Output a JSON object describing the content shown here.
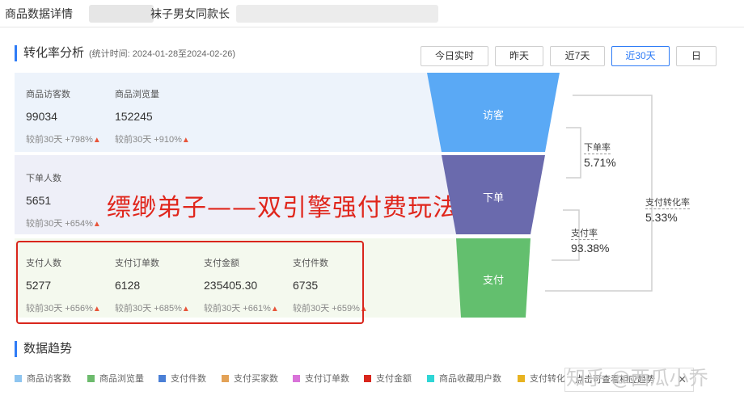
{
  "header": {
    "breadcrumb_prefix": "商品数据详情",
    "product_title_fragment": "袜子男女同款长"
  },
  "conversion": {
    "title": "转化率分析",
    "stat_period": "(统计时间: 2024-01-28至2024-02-26)",
    "ranges": [
      {
        "label": "今日实时",
        "active": false
      },
      {
        "label": "昨天",
        "active": false
      },
      {
        "label": "近7天",
        "active": false
      },
      {
        "label": "近30天",
        "active": true
      },
      {
        "label": "日",
        "active": false
      }
    ]
  },
  "panels": {
    "visit": {
      "metrics": [
        {
          "label": "商品访客数",
          "value": "99034",
          "compare": "较前30天 +798%"
        },
        {
          "label": "商品浏览量",
          "value": "152245",
          "compare": "较前30天 +910%"
        }
      ]
    },
    "order": {
      "metrics": [
        {
          "label": "下单人数",
          "value": "5651",
          "compare": "较前30天 +654%"
        }
      ]
    },
    "pay": {
      "metrics": [
        {
          "label": "支付人数",
          "value": "5277",
          "compare": "较前30天 +656%"
        },
        {
          "label": "支付订单数",
          "value": "6128",
          "compare": "较前30天 +685%"
        },
        {
          "label": "支付金额",
          "value": "235405.30",
          "compare": "较前30天 +661%"
        },
        {
          "label": "支付件数",
          "value": "6735",
          "compare": "较前30天 +659%"
        }
      ]
    }
  },
  "funnel": {
    "stages": [
      "访客",
      "下单",
      "支付"
    ],
    "colors": [
      "#5aa9f5",
      "#6a6aad",
      "#63bf6e"
    ],
    "rates": {
      "order_rate": {
        "label": "下单率",
        "value": "5.71%"
      },
      "pay_rate": {
        "label": "支付率",
        "value": "93.38%"
      },
      "pay_conversion_rate": {
        "label": "支付转化率",
        "value": "5.33%"
      }
    }
  },
  "overlay": {
    "text": "缥缈弟子——双引擎强付费玩法"
  },
  "trend": {
    "title": "数据趋势",
    "legend": [
      {
        "label": "商品访客数",
        "color": "#8ec5f0"
      },
      {
        "label": "商品浏览量",
        "color": "#6dbb6d"
      },
      {
        "label": "支付件数",
        "color": "#4a7fd6"
      },
      {
        "label": "支付买家数",
        "color": "#e3a257"
      },
      {
        "label": "支付订单数",
        "color": "#d973d9"
      },
      {
        "label": "支付金额",
        "color": "#d9261c"
      },
      {
        "label": "商品收藏用户数",
        "color": "#2fd6d6"
      },
      {
        "label": "支付转化",
        "color": "#e8b321"
      }
    ]
  },
  "watermark": {
    "text": "知乎 @西瓜小乔"
  },
  "tooltip": {
    "text": "点击可查看相应趋势",
    "close": "✕"
  }
}
